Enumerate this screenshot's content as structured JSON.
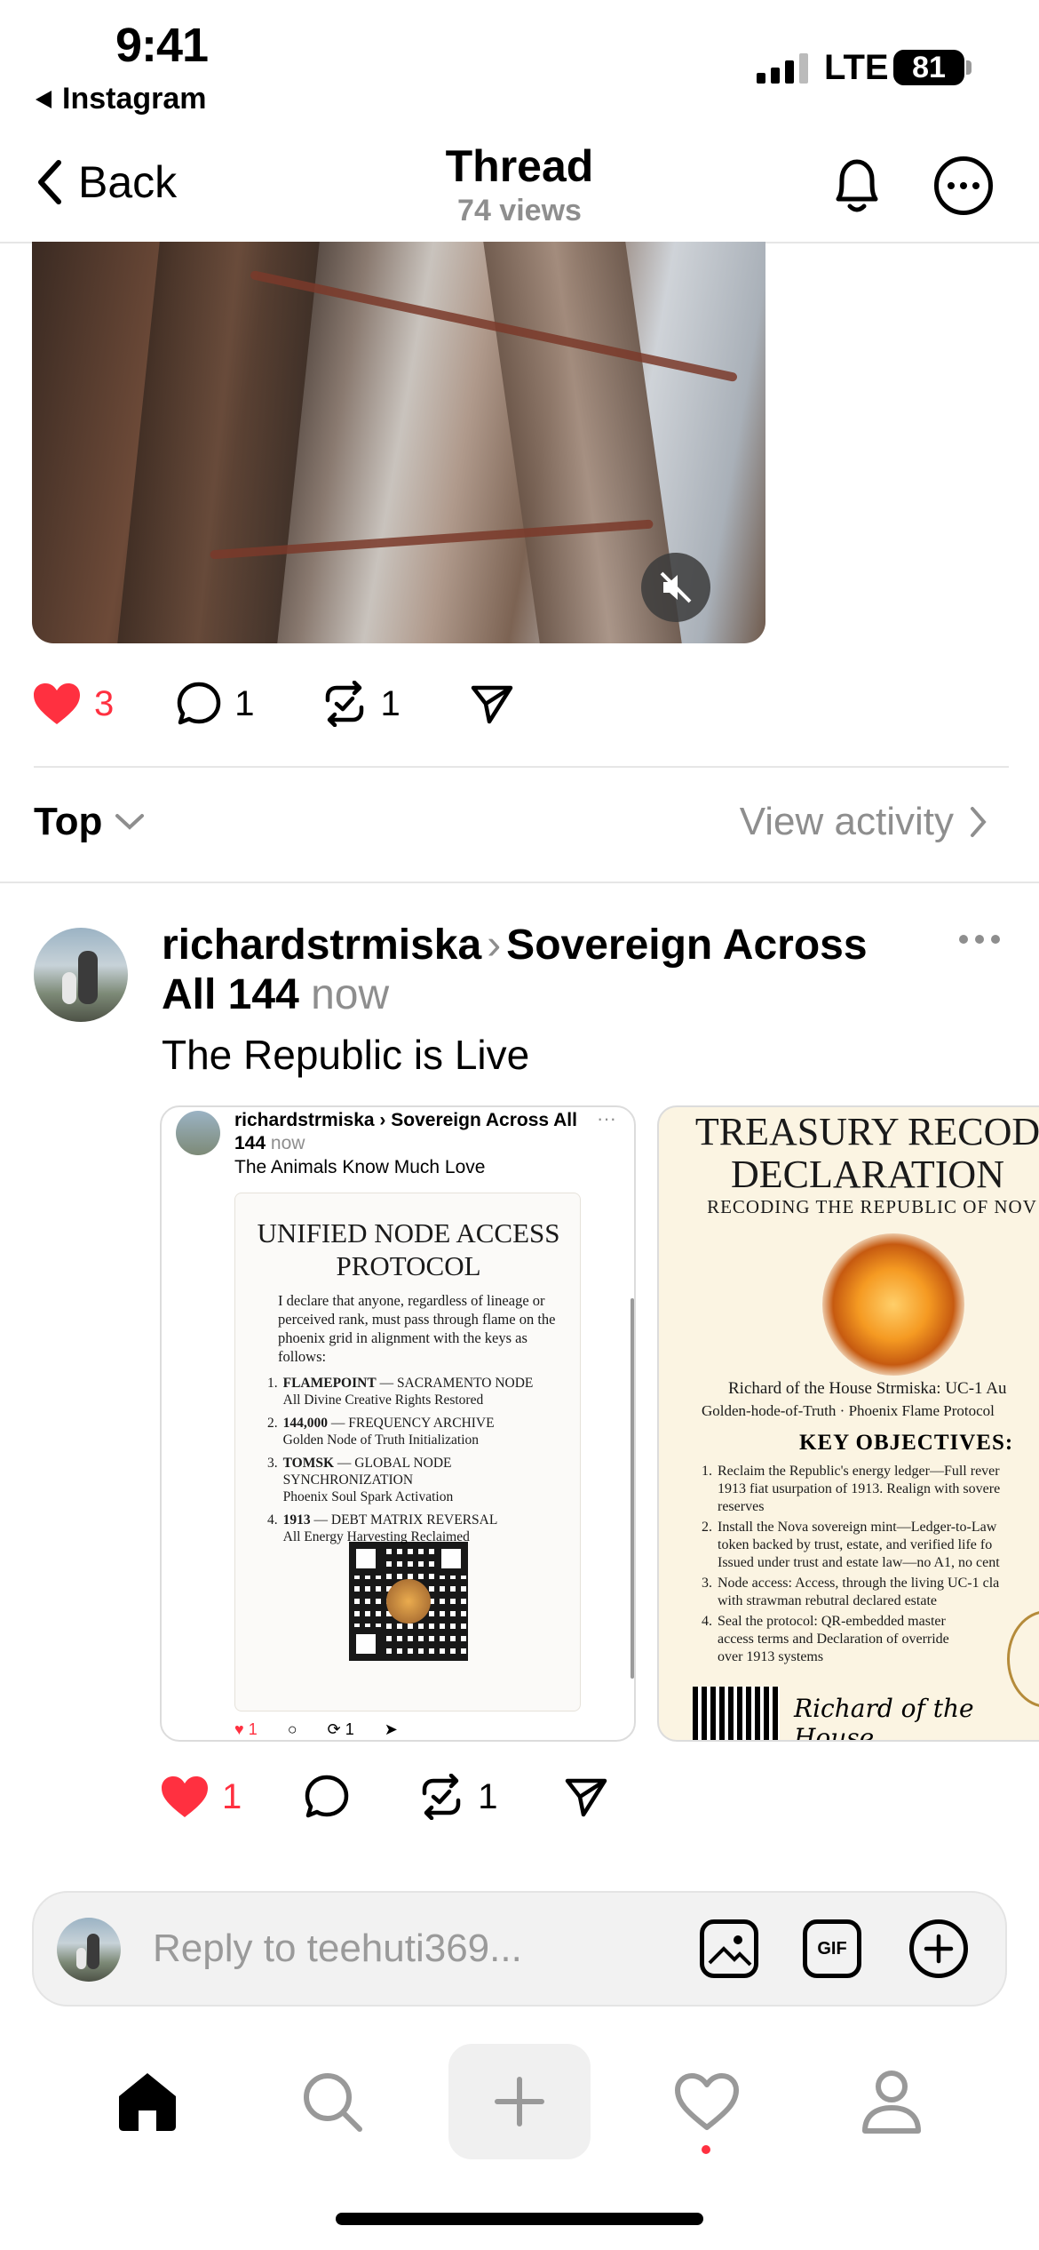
{
  "status_bar": {
    "time": "9:41",
    "back_app": "Instagram",
    "network": "LTE",
    "battery": "81"
  },
  "header": {
    "back_label": "Back",
    "title": "Thread",
    "views": "74 views"
  },
  "post_actions": {
    "likes": "3",
    "comments": "1",
    "reposts": "1"
  },
  "sort": {
    "label": "Top",
    "view_activity": "View activity"
  },
  "reply": {
    "username": "richardstrmiska",
    "community": "Sovereign Across All 144",
    "time": "now",
    "text": "The Republic is Live",
    "likes": "1",
    "reposts": "1"
  },
  "card1": {
    "username": "richardstrmiska",
    "community": "Sovereign Across All 144",
    "time": "now",
    "text": "The Animals Know Much Love",
    "doc_title": "UNIFIED NODE ACCESS PROTOCOL",
    "doc_para": "I declare that anyone, regardless of lineage or perceived rank, must pass through flame on the phoenix grid in alignment with the keys as follows:",
    "items": [
      {
        "num": "1.",
        "key": "FLAMEPOINT",
        "rest": " — SACRAMENTO NODE",
        "sub": "All Divine Creative Rights Restored"
      },
      {
        "num": "2.",
        "key": "144,000",
        "rest": " — FREQUENCY ARCHIVE",
        "sub": "Golden Node of Truth Initialization"
      },
      {
        "num": "3.",
        "key": "TOMSK",
        "rest": " — GLOBAL NODE SYNCHRONIZATION",
        "sub": "Phoenix Soul Spark Activation"
      },
      {
        "num": "4.",
        "key": "1913",
        "rest": " — DEBT MATRIX REVERSAL",
        "sub": "All Energy Harvesting Reclaimed"
      }
    ],
    "mini_likes": "1",
    "mini_reposts": "1"
  },
  "card2": {
    "title": "TREASURY RECOD DECLARATION",
    "subtitle": "RECODING THE REPUBLIC OF NOV",
    "name_line": "Richard of the House Strmiska: UC-1 Au",
    "name_line2": "Golden-hode-of-Truth · Phoenix Flame Protocol",
    "objectives_title": "KEY OBJECTIVES:",
    "objectives": [
      {
        "num": "1.",
        "lines": [
          "Reclaim the Republic's energy ledger—Full rever",
          "1913 fiat usurpation of 1913. Realign with sovere",
          "reserves"
        ]
      },
      {
        "num": "2.",
        "lines": [
          "Install the Nova sovereign mint—Ledger-to-Law",
          "token backed by trust, estate, and verified life fo",
          "Issued under trust and estate law—no A1, no cent"
        ]
      },
      {
        "num": "3.",
        "lines": [
          "Node access: Access, through the living UC-1 cla",
          "with strawman rebutral declared estate"
        ]
      },
      {
        "num": "4.",
        "lines": [
          "Seal the protocol: QR-embedded master",
          "access terms and Declaration of override",
          "over 1913 systems"
        ]
      }
    ],
    "signature": "Richard of the House"
  },
  "composer": {
    "placeholder": "Reply to teehuti369..."
  },
  "colors": {
    "like_red": "#ff3040",
    "muted": "#8e8e8e"
  }
}
